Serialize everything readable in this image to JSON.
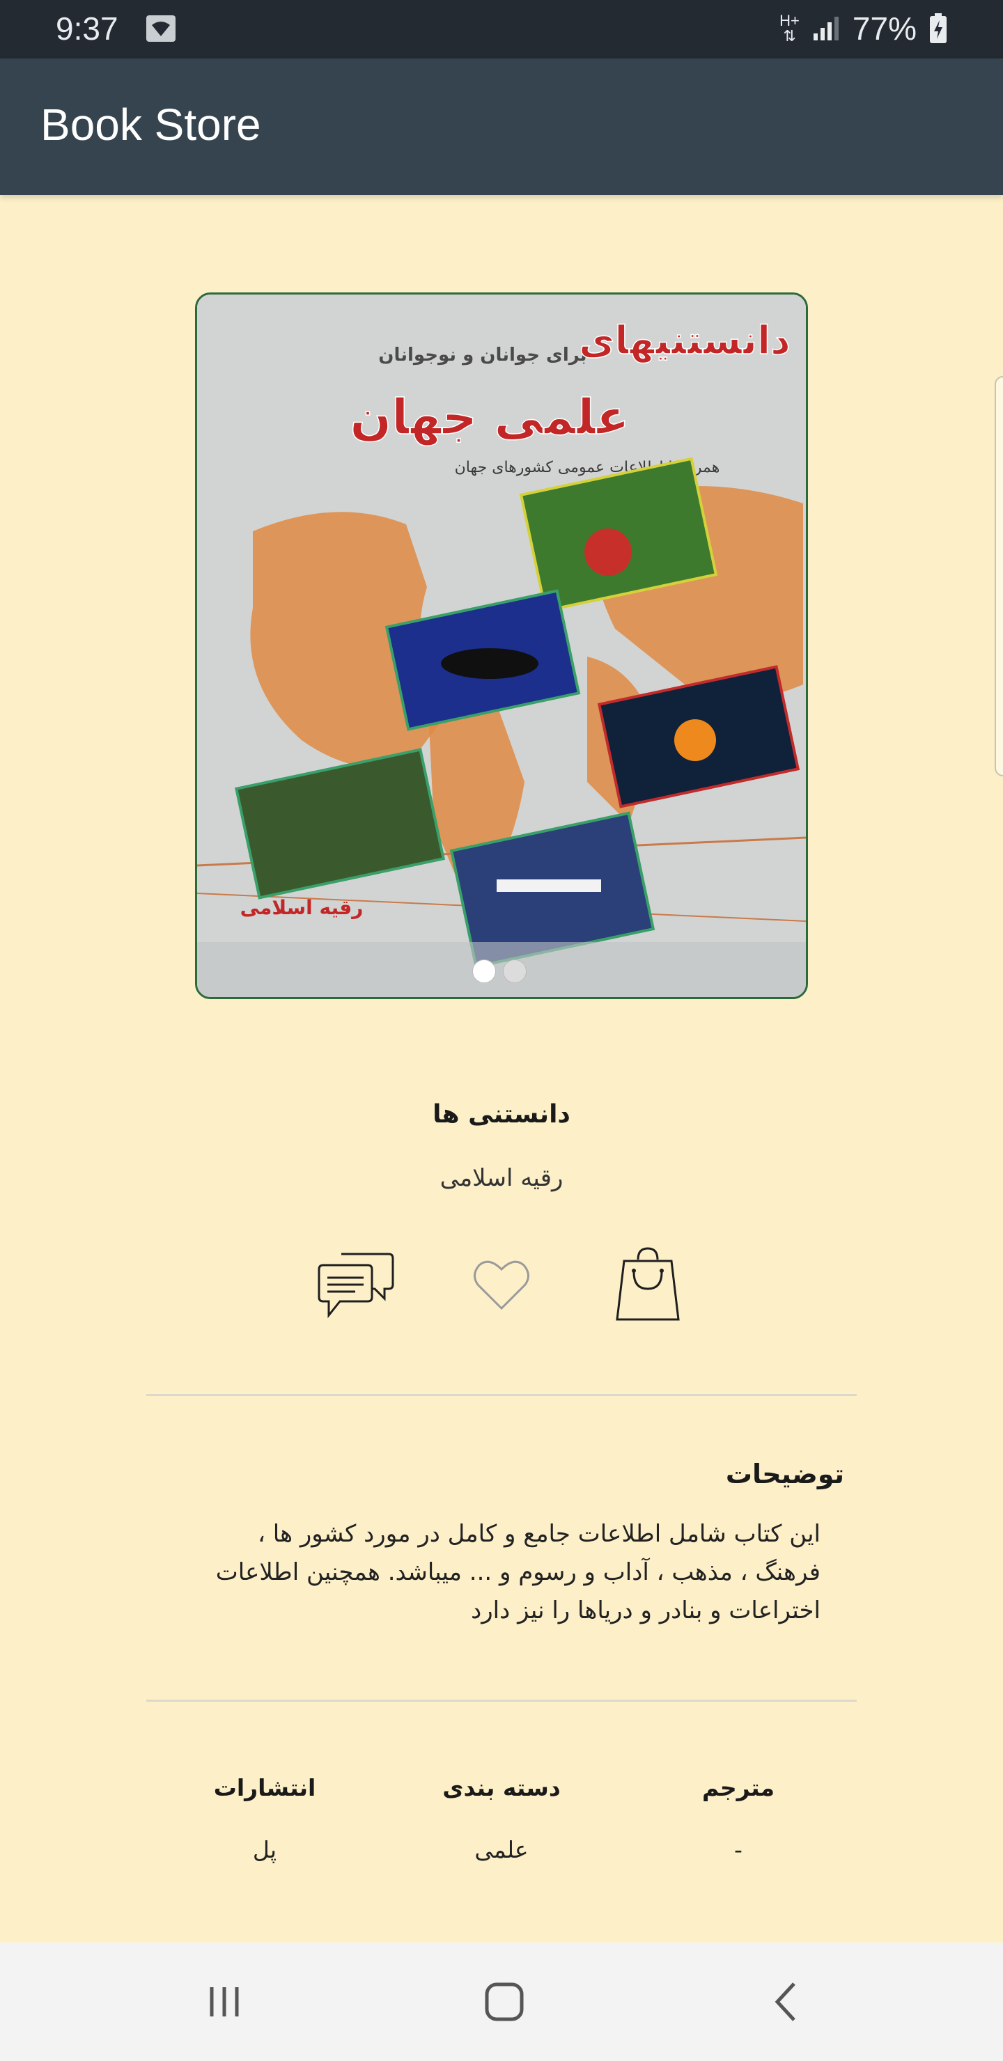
{
  "status_bar": {
    "time": "9:37",
    "network_type_top": "H+",
    "battery_percent": "77%",
    "icons": [
      "wifi-icon",
      "data-transfer-icon",
      "signal-icon",
      "battery-charging-icon"
    ]
  },
  "app_bar": {
    "title": "Book Store"
  },
  "carousel": {
    "image_count": 2,
    "active_index": 0,
    "cover_lettering": {
      "top_small": "برای جوانان و نوجوانان",
      "title_line1": "دانستنیهای",
      "title_line2": "علمی جهان",
      "subtitle": "همراه با اطلاعات عمومی کشورهای جهان",
      "author": "رقیه اسلامی"
    }
  },
  "book": {
    "title": "دانستنی ها",
    "author": "رقیه اسلامی"
  },
  "actions": [
    {
      "name": "comments-button",
      "icon": "comments-icon"
    },
    {
      "name": "favorite-button",
      "icon": "heart-icon"
    },
    {
      "name": "add-to-cart-button",
      "icon": "shopping-bag-icon"
    }
  ],
  "description": {
    "heading": "توضیحات",
    "lines": [
      "این کتاب شامل اطلاعات جامع و کامل در مورد کشور ها ،",
      "فرهنگ ، مذهب ، آداب و رسوم و ... میباشد. همچنین اطلاعات",
      "اختراعات و بنادر و دریاها را نیز دارد"
    ]
  },
  "meta": {
    "translator": {
      "label": "مترجم",
      "value": "-"
    },
    "category": {
      "label": "دسته بندی",
      "value": "علمی"
    },
    "publisher": {
      "label": "انتشارات",
      "value": "پل"
    }
  },
  "nav_bar": {
    "icons": [
      "recent-apps-icon",
      "home-icon",
      "back-icon"
    ]
  },
  "colors": {
    "background": "#fdf0c9",
    "app_bar": "#36444f",
    "status_bar": "#232a31",
    "nav_bar": "#f3f3f3"
  }
}
